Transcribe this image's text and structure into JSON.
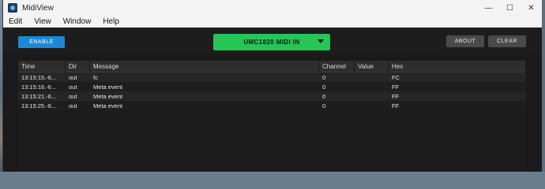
{
  "window": {
    "title": "MidiView",
    "controls": {
      "minimize": "—",
      "maximize": "☐",
      "close": "✕"
    }
  },
  "menu": [
    "Edit",
    "View",
    "Window",
    "Help"
  ],
  "toolbar": {
    "enable_label": "ENABLE",
    "device_label": "UMC1820 MIDI IN",
    "about_label": "ABOUT",
    "clear_label": "CLEAR"
  },
  "colors": {
    "enable": "#1e88d8",
    "device": "#27c456",
    "button_gray": "#4a4a4a"
  },
  "table": {
    "columns": [
      "Time",
      "Dir",
      "Message",
      "Channel",
      "Value",
      "Hex"
    ],
    "rows": [
      {
        "time": "13:15:15.-6...",
        "dir": "out",
        "message": "fc",
        "channel": "0",
        "value": "",
        "hex": "FC"
      },
      {
        "time": "13:15:16.-6...",
        "dir": "out",
        "message": "Meta event",
        "channel": "0",
        "value": "",
        "hex": "FF"
      },
      {
        "time": "13:15:21.-6...",
        "dir": "out",
        "message": "Meta event",
        "channel": "0",
        "value": "",
        "hex": "FF"
      },
      {
        "time": "13:15:25.-6...",
        "dir": "out",
        "message": "Meta event",
        "channel": "0",
        "value": "",
        "hex": "FF"
      }
    ]
  }
}
